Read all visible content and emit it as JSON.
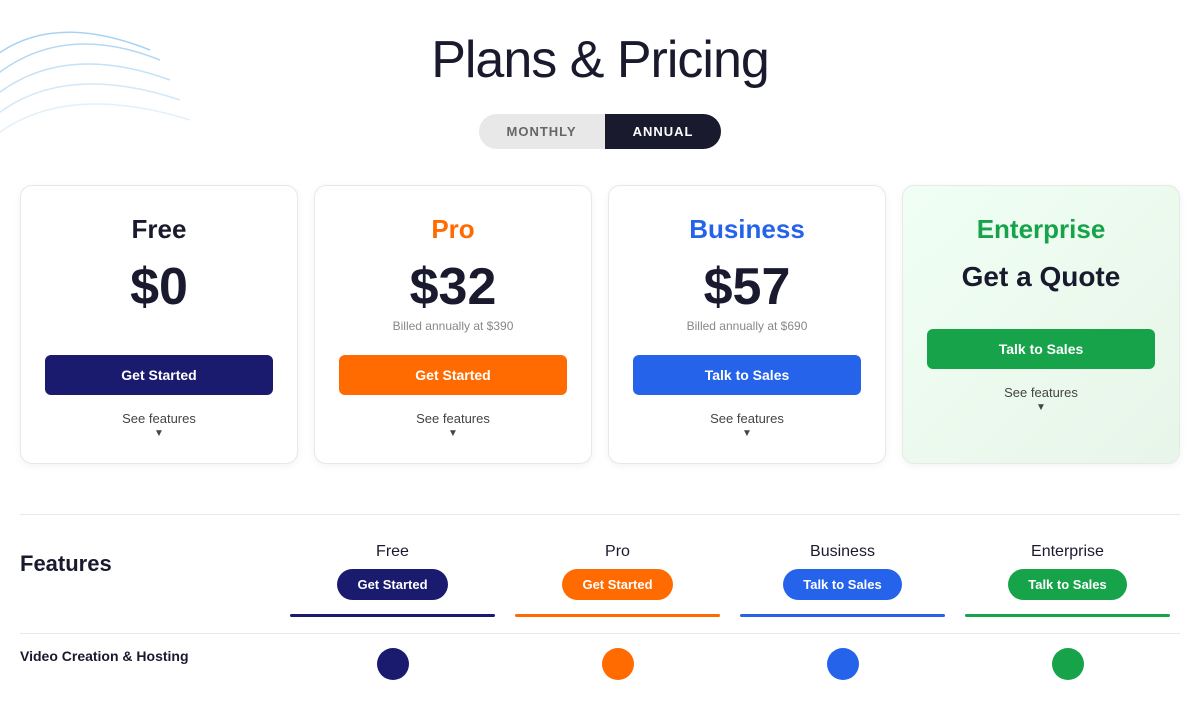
{
  "page": {
    "title": "Plans & Pricing"
  },
  "toggle": {
    "monthly_label": "MONTHLY",
    "annual_label": "ANNUAL",
    "active": "annual"
  },
  "plans": [
    {
      "id": "free",
      "name": "Free",
      "name_class": "free",
      "price": "$0",
      "billed_note": "",
      "btn_label": "Get Started",
      "btn_class": "free-btn",
      "see_features": "See features"
    },
    {
      "id": "pro",
      "name": "Pro",
      "name_class": "pro",
      "price": "$32",
      "billed_note": "Billed annually at $390",
      "btn_label": "Get Started",
      "btn_class": "pro-btn",
      "see_features": "See features"
    },
    {
      "id": "business",
      "name": "Business",
      "name_class": "business",
      "price": "$57",
      "billed_note": "Billed annually at $690",
      "btn_label": "Talk to Sales",
      "btn_class": "business-btn",
      "see_features": "See features"
    },
    {
      "id": "enterprise",
      "name": "Enterprise",
      "name_class": "enterprise",
      "price_label": "Get a Quote",
      "billed_note": "",
      "btn_label": "Talk to Sales",
      "btn_class": "enterprise-btn",
      "see_features": "See features"
    }
  ],
  "features_section": {
    "label": "Features",
    "columns": [
      {
        "id": "free",
        "name": "Free",
        "btn_label": "Get Started",
        "btn_class": "free",
        "bar_class": "bar-free"
      },
      {
        "id": "pro",
        "name": "Pro",
        "btn_label": "Get Started",
        "btn_class": "pro",
        "bar_class": "bar-pro"
      },
      {
        "id": "business",
        "name": "Business",
        "btn_label": "Talk to Sales",
        "btn_class": "business",
        "bar_class": "bar-business"
      },
      {
        "id": "enterprise",
        "name": "Enterprise",
        "btn_label": "Talk to Sales",
        "btn_class": "enterprise",
        "bar_class": "bar-enterprise"
      }
    ]
  },
  "video_creation": {
    "label": "Video Creation & Hosting"
  }
}
